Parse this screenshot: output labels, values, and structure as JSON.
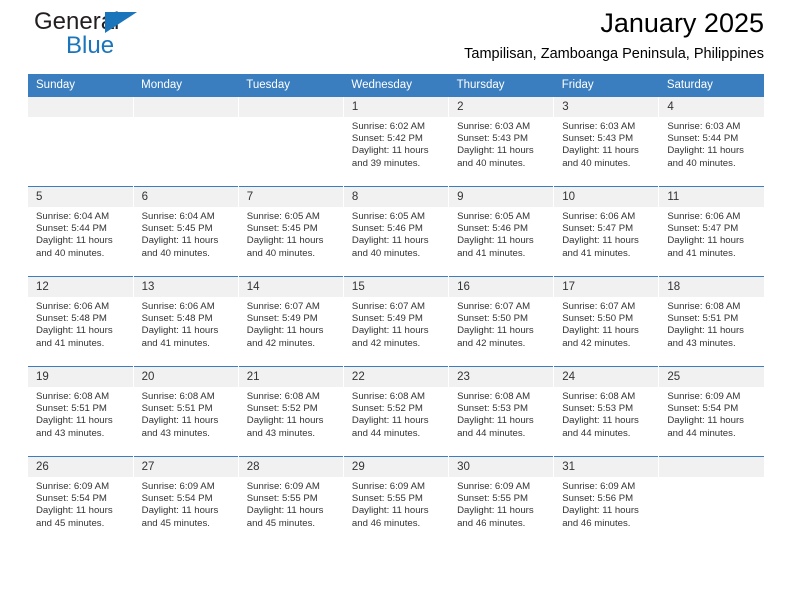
{
  "brand": {
    "name_part1": "General",
    "name_part2": "Blue",
    "accent_color": "#1b75bb",
    "logo_icon": "triangle-icon"
  },
  "header": {
    "title": "January 2025",
    "location": "Tampilisan, Zamboanga Peninsula, Philippines"
  },
  "calendar": {
    "header_color": "#3a7ebf",
    "weekdays": [
      "Sunday",
      "Monday",
      "Tuesday",
      "Wednesday",
      "Thursday",
      "Friday",
      "Saturday"
    ],
    "weeks": [
      [
        {
          "day": "",
          "empty": true
        },
        {
          "day": "",
          "empty": true
        },
        {
          "day": "",
          "empty": true
        },
        {
          "day": "1",
          "sunrise": "Sunrise: 6:02 AM",
          "sunset": "Sunset: 5:42 PM",
          "daylight1": "Daylight: 11 hours",
          "daylight2": "and 39 minutes."
        },
        {
          "day": "2",
          "sunrise": "Sunrise: 6:03 AM",
          "sunset": "Sunset: 5:43 PM",
          "daylight1": "Daylight: 11 hours",
          "daylight2": "and 40 minutes."
        },
        {
          "day": "3",
          "sunrise": "Sunrise: 6:03 AM",
          "sunset": "Sunset: 5:43 PM",
          "daylight1": "Daylight: 11 hours",
          "daylight2": "and 40 minutes."
        },
        {
          "day": "4",
          "sunrise": "Sunrise: 6:03 AM",
          "sunset": "Sunset: 5:44 PM",
          "daylight1": "Daylight: 11 hours",
          "daylight2": "and 40 minutes."
        }
      ],
      [
        {
          "day": "5",
          "sunrise": "Sunrise: 6:04 AM",
          "sunset": "Sunset: 5:44 PM",
          "daylight1": "Daylight: 11 hours",
          "daylight2": "and 40 minutes."
        },
        {
          "day": "6",
          "sunrise": "Sunrise: 6:04 AM",
          "sunset": "Sunset: 5:45 PM",
          "daylight1": "Daylight: 11 hours",
          "daylight2": "and 40 minutes."
        },
        {
          "day": "7",
          "sunrise": "Sunrise: 6:05 AM",
          "sunset": "Sunset: 5:45 PM",
          "daylight1": "Daylight: 11 hours",
          "daylight2": "and 40 minutes."
        },
        {
          "day": "8",
          "sunrise": "Sunrise: 6:05 AM",
          "sunset": "Sunset: 5:46 PM",
          "daylight1": "Daylight: 11 hours",
          "daylight2": "and 40 minutes."
        },
        {
          "day": "9",
          "sunrise": "Sunrise: 6:05 AM",
          "sunset": "Sunset: 5:46 PM",
          "daylight1": "Daylight: 11 hours",
          "daylight2": "and 41 minutes."
        },
        {
          "day": "10",
          "sunrise": "Sunrise: 6:06 AM",
          "sunset": "Sunset: 5:47 PM",
          "daylight1": "Daylight: 11 hours",
          "daylight2": "and 41 minutes."
        },
        {
          "day": "11",
          "sunrise": "Sunrise: 6:06 AM",
          "sunset": "Sunset: 5:47 PM",
          "daylight1": "Daylight: 11 hours",
          "daylight2": "and 41 minutes."
        }
      ],
      [
        {
          "day": "12",
          "sunrise": "Sunrise: 6:06 AM",
          "sunset": "Sunset: 5:48 PM",
          "daylight1": "Daylight: 11 hours",
          "daylight2": "and 41 minutes."
        },
        {
          "day": "13",
          "sunrise": "Sunrise: 6:06 AM",
          "sunset": "Sunset: 5:48 PM",
          "daylight1": "Daylight: 11 hours",
          "daylight2": "and 41 minutes."
        },
        {
          "day": "14",
          "sunrise": "Sunrise: 6:07 AM",
          "sunset": "Sunset: 5:49 PM",
          "daylight1": "Daylight: 11 hours",
          "daylight2": "and 42 minutes."
        },
        {
          "day": "15",
          "sunrise": "Sunrise: 6:07 AM",
          "sunset": "Sunset: 5:49 PM",
          "daylight1": "Daylight: 11 hours",
          "daylight2": "and 42 minutes."
        },
        {
          "day": "16",
          "sunrise": "Sunrise: 6:07 AM",
          "sunset": "Sunset: 5:50 PM",
          "daylight1": "Daylight: 11 hours",
          "daylight2": "and 42 minutes."
        },
        {
          "day": "17",
          "sunrise": "Sunrise: 6:07 AM",
          "sunset": "Sunset: 5:50 PM",
          "daylight1": "Daylight: 11 hours",
          "daylight2": "and 42 minutes."
        },
        {
          "day": "18",
          "sunrise": "Sunrise: 6:08 AM",
          "sunset": "Sunset: 5:51 PM",
          "daylight1": "Daylight: 11 hours",
          "daylight2": "and 43 minutes."
        }
      ],
      [
        {
          "day": "19",
          "sunrise": "Sunrise: 6:08 AM",
          "sunset": "Sunset: 5:51 PM",
          "daylight1": "Daylight: 11 hours",
          "daylight2": "and 43 minutes."
        },
        {
          "day": "20",
          "sunrise": "Sunrise: 6:08 AM",
          "sunset": "Sunset: 5:51 PM",
          "daylight1": "Daylight: 11 hours",
          "daylight2": "and 43 minutes."
        },
        {
          "day": "21",
          "sunrise": "Sunrise: 6:08 AM",
          "sunset": "Sunset: 5:52 PM",
          "daylight1": "Daylight: 11 hours",
          "daylight2": "and 43 minutes."
        },
        {
          "day": "22",
          "sunrise": "Sunrise: 6:08 AM",
          "sunset": "Sunset: 5:52 PM",
          "daylight1": "Daylight: 11 hours",
          "daylight2": "and 44 minutes."
        },
        {
          "day": "23",
          "sunrise": "Sunrise: 6:08 AM",
          "sunset": "Sunset: 5:53 PM",
          "daylight1": "Daylight: 11 hours",
          "daylight2": "and 44 minutes."
        },
        {
          "day": "24",
          "sunrise": "Sunrise: 6:08 AM",
          "sunset": "Sunset: 5:53 PM",
          "daylight1": "Daylight: 11 hours",
          "daylight2": "and 44 minutes."
        },
        {
          "day": "25",
          "sunrise": "Sunrise: 6:09 AM",
          "sunset": "Sunset: 5:54 PM",
          "daylight1": "Daylight: 11 hours",
          "daylight2": "and 44 minutes."
        }
      ],
      [
        {
          "day": "26",
          "sunrise": "Sunrise: 6:09 AM",
          "sunset": "Sunset: 5:54 PM",
          "daylight1": "Daylight: 11 hours",
          "daylight2": "and 45 minutes."
        },
        {
          "day": "27",
          "sunrise": "Sunrise: 6:09 AM",
          "sunset": "Sunset: 5:54 PM",
          "daylight1": "Daylight: 11 hours",
          "daylight2": "and 45 minutes."
        },
        {
          "day": "28",
          "sunrise": "Sunrise: 6:09 AM",
          "sunset": "Sunset: 5:55 PM",
          "daylight1": "Daylight: 11 hours",
          "daylight2": "and 45 minutes."
        },
        {
          "day": "29",
          "sunrise": "Sunrise: 6:09 AM",
          "sunset": "Sunset: 5:55 PM",
          "daylight1": "Daylight: 11 hours",
          "daylight2": "and 46 minutes."
        },
        {
          "day": "30",
          "sunrise": "Sunrise: 6:09 AM",
          "sunset": "Sunset: 5:55 PM",
          "daylight1": "Daylight: 11 hours",
          "daylight2": "and 46 minutes."
        },
        {
          "day": "31",
          "sunrise": "Sunrise: 6:09 AM",
          "sunset": "Sunset: 5:56 PM",
          "daylight1": "Daylight: 11 hours",
          "daylight2": "and 46 minutes."
        },
        {
          "day": "",
          "empty": true
        }
      ]
    ]
  }
}
